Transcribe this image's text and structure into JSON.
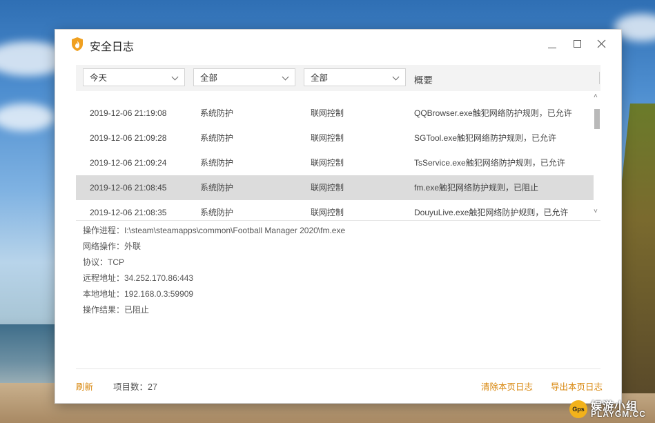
{
  "window": {
    "title": "安全日志"
  },
  "filters": [
    {
      "value": "今天"
    },
    {
      "value": "全部"
    },
    {
      "value": "全部"
    }
  ],
  "filter_label": "概要",
  "rows": [
    {
      "time": "2019-12-06 21:19:08",
      "category": "系统防护",
      "type": "联网控制",
      "summary": "QQBrowser.exe触犯网络防护规则，已允许"
    },
    {
      "time": "2019-12-06 21:09:28",
      "category": "系统防护",
      "type": "联网控制",
      "summary": "SGTool.exe触犯网络防护规则，已允许"
    },
    {
      "time": "2019-12-06 21:09:24",
      "category": "系统防护",
      "type": "联网控制",
      "summary": "TsService.exe触犯网络防护规则，已允许"
    },
    {
      "time": "2019-12-06 21:08:45",
      "category": "系统防护",
      "type": "联网控制",
      "summary": "fm.exe触犯网络防护规则，已阻止"
    },
    {
      "time": "2019-12-06 21:08:35",
      "category": "系统防护",
      "type": "联网控制",
      "summary": "DouyuLive.exe触犯网络防护规则，已允许"
    }
  ],
  "selected_row": 3,
  "details": [
    "操作进程：I:\\steam\\steamapps\\common\\Football Manager 2020\\fm.exe",
    "网络操作：外联",
    "协议：TCP",
    "远程地址：34.252.170.86:443",
    "本地地址：192.168.0.3:59909",
    "操作结果：已阻止"
  ],
  "footer": {
    "refresh": "刷新",
    "count": "项目数：27",
    "clear": "清除本页日志",
    "export": "导出本页日志"
  },
  "watermark": {
    "ball": "Gps",
    "top": "娱游小组",
    "bottom": "PLAYGM.CC"
  },
  "colors": {
    "accent": "#d8860b",
    "selected_row": "#dcdcdc",
    "icon": "#f0a020"
  }
}
